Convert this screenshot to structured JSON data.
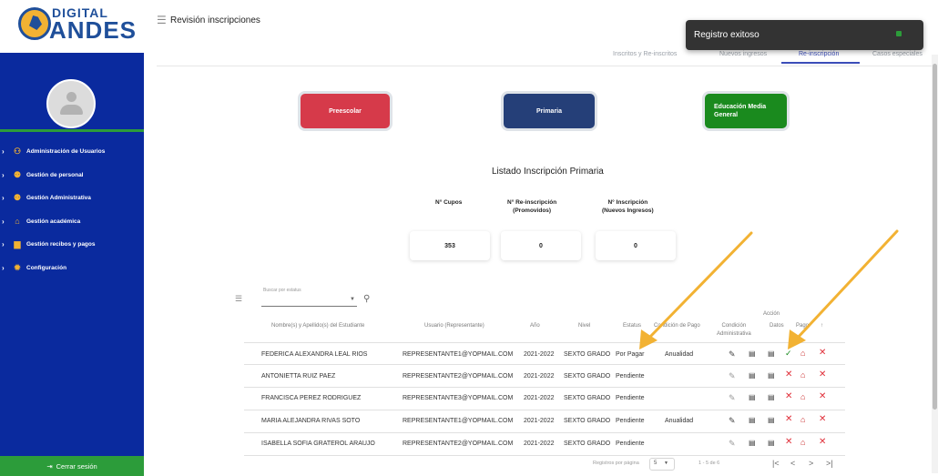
{
  "brand": {
    "word1": "DIGITAL",
    "word2": "ANDES"
  },
  "sidebar": {
    "items": [
      {
        "label": "Administración de Usuarios",
        "icon": "users-icon"
      },
      {
        "label": "Gestión de personal",
        "icon": "people-icon"
      },
      {
        "label": "Gestión Administrativa",
        "icon": "people-icon"
      },
      {
        "label": "Gestión académica",
        "icon": "bank-icon"
      },
      {
        "label": "Gestión recibos y pagos",
        "icon": "briefcase-icon"
      },
      {
        "label": "Configuración",
        "icon": "gear-icon"
      }
    ],
    "logout": "Cerrar sesión"
  },
  "header": {
    "title": "Revisión inscripciones"
  },
  "tabs": [
    "Inscritos y Re-inscritos",
    "Nuevos ingresos",
    "Re-inscripción",
    "Casos especiales"
  ],
  "active_tab": "Re-inscripción",
  "toast": {
    "message": "Registro exitoso"
  },
  "levels": {
    "preescolar": "Preescolar",
    "primaria": "Primaria",
    "media_1": "Educación Media",
    "media_2": "General"
  },
  "list": {
    "title": "Listado Inscripción Primaria",
    "stats": [
      {
        "label1": "N° Cupos",
        "label2": "",
        "value": "353"
      },
      {
        "label1": "N° Re-inscripción",
        "label2": "(Promovidos)",
        "value": "0"
      },
      {
        "label1": "N° Inscripción",
        "label2": "(Nuevos Ingresos)",
        "value": "0"
      }
    ]
  },
  "search": {
    "label": "Buscar por estatus"
  },
  "table": {
    "headers": {
      "nombre": "Nombre(s) y Apellido(s) del Estudiante",
      "usuario": "Usuario (Representante)",
      "anio": "Año",
      "nivel": "Nivel",
      "estatus": "Estatus",
      "condicion_pago": "Condición de Pago",
      "accion": "Acción",
      "cond_adm_1": "Condición",
      "cond_adm_2": "Administrativa",
      "datos": "Datos",
      "pago": "Pago",
      "sort": "↑"
    },
    "rows": [
      {
        "nombre": "FEDERICA ALEXANDRA LEAL RIOS",
        "usuario": "REPRESENTANTE1@YOPMAIL.COM",
        "anio": "2021-2022",
        "nivel": "SEXTO GRADO",
        "estatus": "Por Pagar",
        "pago": "Anualidad",
        "approved": true
      },
      {
        "nombre": "ANTONIETTA RUIZ PAEZ",
        "usuario": "REPRESENTANTE2@YOPMAIL.COM",
        "anio": "2021-2022",
        "nivel": "SEXTO GRADO",
        "estatus": "Pendiente",
        "pago": "",
        "approved": false
      },
      {
        "nombre": "FRANCISCA PEREZ RODRIGUEZ",
        "usuario": "REPRESENTANTE3@YOPMAIL.COM",
        "anio": "2021-2022",
        "nivel": "SEXTO GRADO",
        "estatus": "Pendiente",
        "pago": "",
        "approved": false
      },
      {
        "nombre": "MARIA ALEJANDRA RIVAS SOTO",
        "usuario": "REPRESENTANTE1@YOPMAIL.COM",
        "anio": "2021-2022",
        "nivel": "SEXTO GRADO",
        "estatus": "Pendiente",
        "pago": "Anualidad",
        "approved": false
      },
      {
        "nombre": "ISABELLA SOFIA GRATEROL ARAUJO",
        "usuario": "REPRESENTANTE2@YOPMAIL.COM",
        "anio": "2021-2022",
        "nivel": "SEXTO GRADO",
        "estatus": "Pendiente",
        "pago": "",
        "approved": false
      }
    ]
  },
  "pagination": {
    "rows_label": "Registros por página",
    "rows_value": "5",
    "range": "1 - 5 de 6",
    "first": "|<",
    "prev": "<",
    "next": ">",
    "last": ">|"
  },
  "colors": {
    "sidebar": "#0a2a9e",
    "accent_green": "#2c9c3a",
    "preescolar": "#d63a4a",
    "primaria": "#253f78",
    "media": "#1a8a1e",
    "active_tab": "#3b4db8",
    "annotation_arrow": "#f2b233"
  }
}
